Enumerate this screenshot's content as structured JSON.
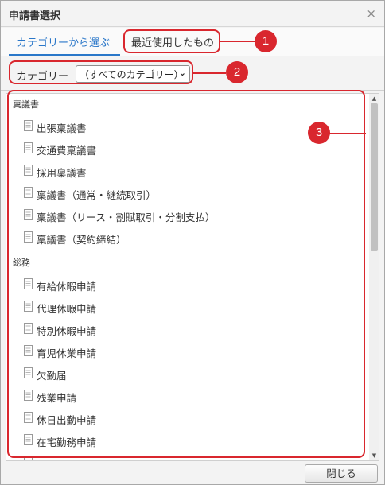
{
  "dialog": {
    "title": "申請書選択"
  },
  "tabs": [
    {
      "label": "カテゴリーから選ぶ",
      "active": true
    },
    {
      "label": "最近使用したもの",
      "active": false
    }
  ],
  "category": {
    "label": "カテゴリー",
    "selected": "（すべてのカテゴリー）"
  },
  "groups": [
    {
      "name": "稟議書",
      "items": [
        "出張稟議書",
        "交通費稟議書",
        "採用稟議書",
        "稟議書（通常・継続取引）",
        "稟議書（リース・割賦取引・分割支払）",
        "稟議書（契約締結）"
      ]
    },
    {
      "name": "総務",
      "items": [
        "有給休暇申請",
        "代理休暇申請",
        "特別休暇申請",
        "育児休業申請",
        "欠勤届",
        "残業申請",
        "休日出勤申請",
        "在宅勤務申請"
      ]
    }
  ],
  "footer": {
    "close_label": "閉じる"
  },
  "annotations": [
    "1",
    "2",
    "3"
  ],
  "colors": {
    "accent": "#2a77c9",
    "annotation": "#d9272e"
  }
}
